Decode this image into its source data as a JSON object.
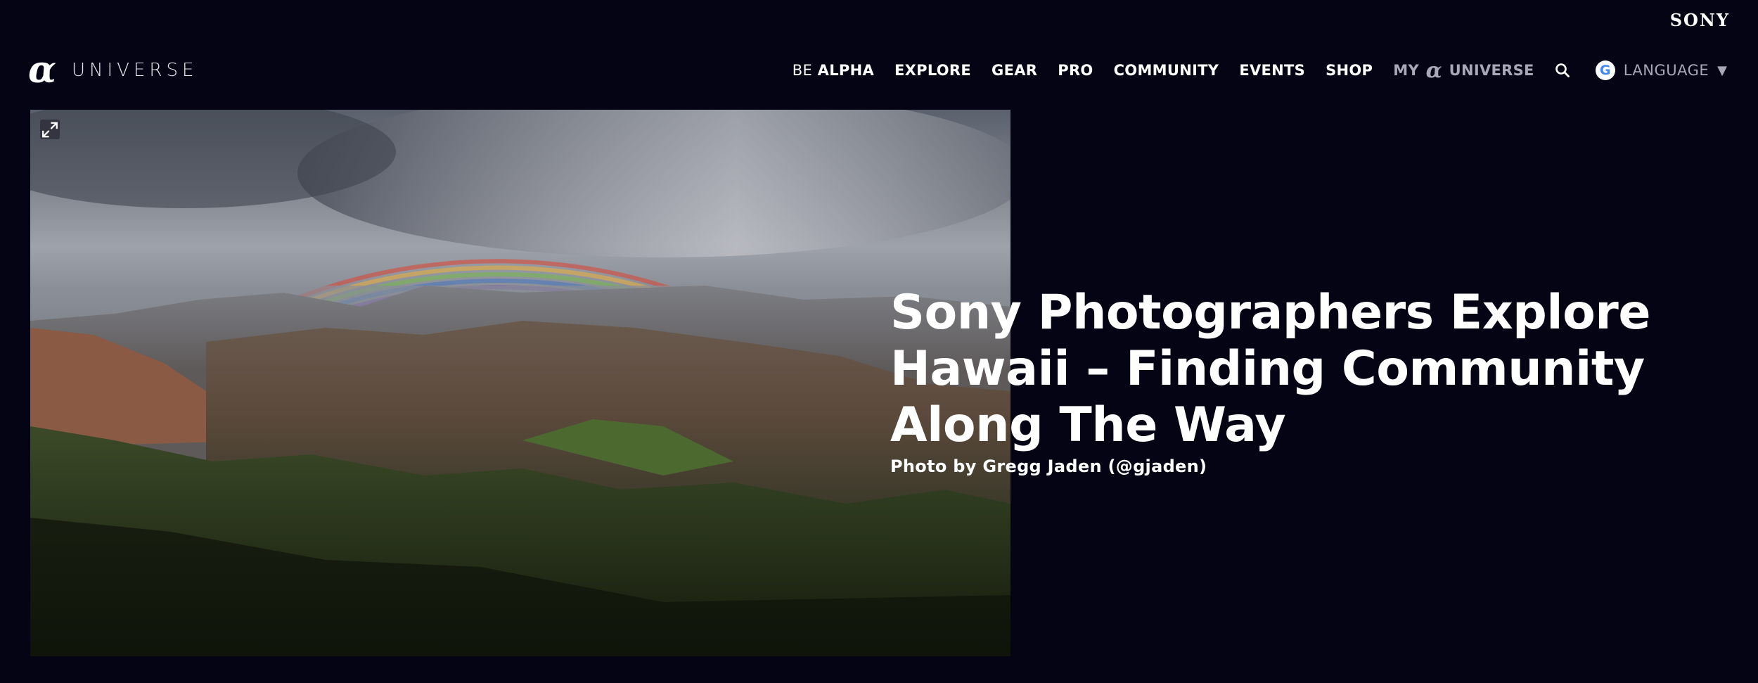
{
  "brand": {
    "corporate": "SONY",
    "alpha_glyph": "α",
    "name": "UNIVERSE"
  },
  "nav": {
    "be_alpha_prefix": "BE",
    "be_alpha_main": "ALPHA",
    "explore": "EXPLORE",
    "gear": "GEAR",
    "pro": "PRO",
    "community": "COMMUNITY",
    "events": "EVENTS",
    "shop": "SHOP",
    "my_prefix": "MY",
    "my_alpha": "α",
    "my_suffix": "UNIVERSE",
    "search_icon": "search-icon",
    "language_label": "LANGUAGE",
    "language_caret": "▼",
    "google_letter": "G"
  },
  "hero": {
    "title": "Sony Photographers Explore Hawaii – Finding Community Along The Way",
    "credit": "Photo by Gregg Jaden (@gjaden)",
    "expand_icon": "expand-icon"
  },
  "colors": {
    "background": "#050414",
    "text": "#ffffff",
    "muted_nav": "#a8a8b6"
  }
}
